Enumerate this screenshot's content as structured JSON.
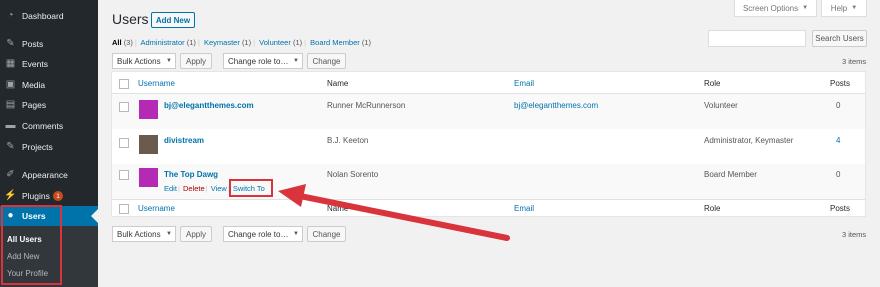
{
  "sidebar": {
    "items": [
      {
        "id": "dashboard",
        "label": "Dashboard",
        "icon": "dashboard-icon",
        "glyph": "◔"
      },
      {
        "id": "posts",
        "label": "Posts",
        "icon": "pin-icon",
        "glyph": "✎"
      },
      {
        "id": "events",
        "label": "Events",
        "icon": "calendar-icon",
        "glyph": "▦"
      },
      {
        "id": "media",
        "label": "Media",
        "icon": "media-icon",
        "glyph": "▣"
      },
      {
        "id": "pages",
        "label": "Pages",
        "icon": "pages-icon",
        "glyph": "▤"
      },
      {
        "id": "comments",
        "label": "Comments",
        "icon": "comment-icon",
        "glyph": "▬"
      },
      {
        "id": "projects",
        "label": "Projects",
        "icon": "pin-icon",
        "glyph": "✎"
      },
      {
        "id": "appearance",
        "label": "Appearance",
        "icon": "paintbrush-icon",
        "glyph": "✐"
      },
      {
        "id": "plugins",
        "label": "Plugins",
        "icon": "plugin-icon",
        "glyph": "⚡",
        "badge": "1"
      },
      {
        "id": "users",
        "label": "Users",
        "icon": "user-icon",
        "glyph": "●"
      }
    ],
    "submenu": [
      "All Users",
      "Add New",
      "Your Profile"
    ]
  },
  "header": {
    "title": "Users",
    "add_new": "Add New",
    "screen_options": "Screen Options",
    "help": "Help"
  },
  "filters": {
    "all": "All",
    "all_count": "(3)",
    "roles": [
      {
        "label": "Administrator",
        "count": "(1)"
      },
      {
        "label": "Keymaster",
        "count": "(1)"
      },
      {
        "label": "Volunteer",
        "count": "(1)"
      },
      {
        "label": "Board Member",
        "count": "(1)"
      }
    ]
  },
  "search": {
    "value": "",
    "button": "Search Users"
  },
  "bulk": {
    "select": "Bulk Actions",
    "apply": "Apply",
    "role_select": "Change role to…",
    "change": "Change"
  },
  "items_count": "3 items",
  "table": {
    "columns": {
      "username": "Username",
      "name": "Name",
      "email": "Email",
      "role": "Role",
      "posts": "Posts"
    },
    "rows": [
      {
        "username": "bj@elegantthemes.com",
        "name": "Runner McRunnerson",
        "email": "bj@elegantthemes.com",
        "role": "Volunteer",
        "posts": "0",
        "avatar_color": "#b52ab5"
      },
      {
        "username": "divistream",
        "name": "B.J. Keeton",
        "email": "",
        "role": "Administrator, Keymaster",
        "posts": "4",
        "avatar_color": "#6b5a4e"
      },
      {
        "username": "The Top Dawg",
        "name": "Nolan Sorento",
        "email": "",
        "role": "Board Member",
        "posts": "0",
        "avatar_color": "#b52ab5"
      }
    ],
    "row_actions": {
      "edit": "Edit",
      "delete": "Delete",
      "view": "View",
      "switch_to": "Switch To"
    }
  },
  "colors": {
    "accent": "#0073aa",
    "highlight": "#d9333b",
    "sidebar": "#23282d"
  }
}
